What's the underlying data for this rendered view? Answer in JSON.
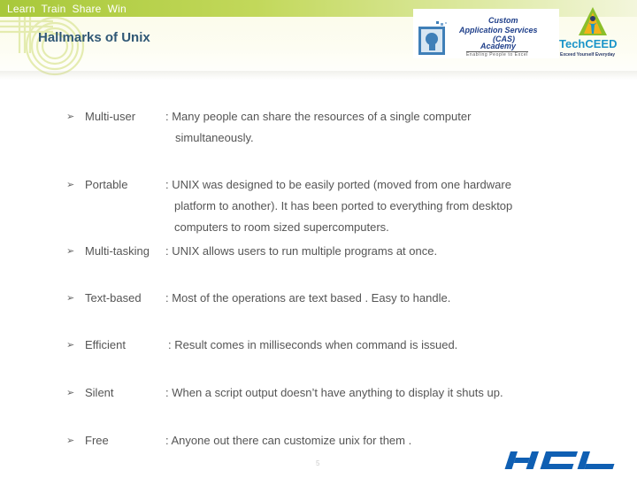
{
  "header": {
    "tagline": "Learn  Train  Share  Win",
    "title": "Hallmarks of Unix",
    "colors": {
      "bar": "#a8c83a",
      "title": "#2f5775"
    }
  },
  "logos": {
    "cas": {
      "line1": "Custom",
      "line2": "Application Services",
      "line3": "(CAS)",
      "line4": "Academy",
      "line5": "Enabling People to Excel"
    },
    "techceed": {
      "name": "TechCEED",
      "tagline": "Exceed Yourself Everyday"
    },
    "hcl": {
      "name": "HCL",
      "color": "#0f5fb3"
    }
  },
  "items": [
    {
      "label": "Multi-user",
      "lines": [
        ": Many people can  share the resources of a single computer",
        "simultaneously."
      ]
    },
    {
      "label": "Portable",
      "lines": [
        ": UNIX was designed to be easily ported (moved from one hardware",
        "platform to another). It has been ported to everything from desktop",
        "computers to room sized supercomputers."
      ]
    },
    {
      "label": "Multi-tasking",
      "lines": [
        ": UNIX allows users to run multiple programs at once."
      ]
    },
    {
      "label": "Text-based",
      "lines": [
        ":  Most of the operations are text based . Easy to handle."
      ]
    },
    {
      "label": "Efficient",
      "lines": [
        ": Result comes in milliseconds when command is issued."
      ]
    },
    {
      "label": "Silent",
      "lines": [
        ":  When  a script output doesn’t have anything to display it shuts up."
      ]
    },
    {
      "label": "Free",
      "lines": [
        ":  Anyone out there can customize  unix for them  ."
      ]
    }
  ],
  "bullet_glyph": "➢",
  "page_number": "5"
}
